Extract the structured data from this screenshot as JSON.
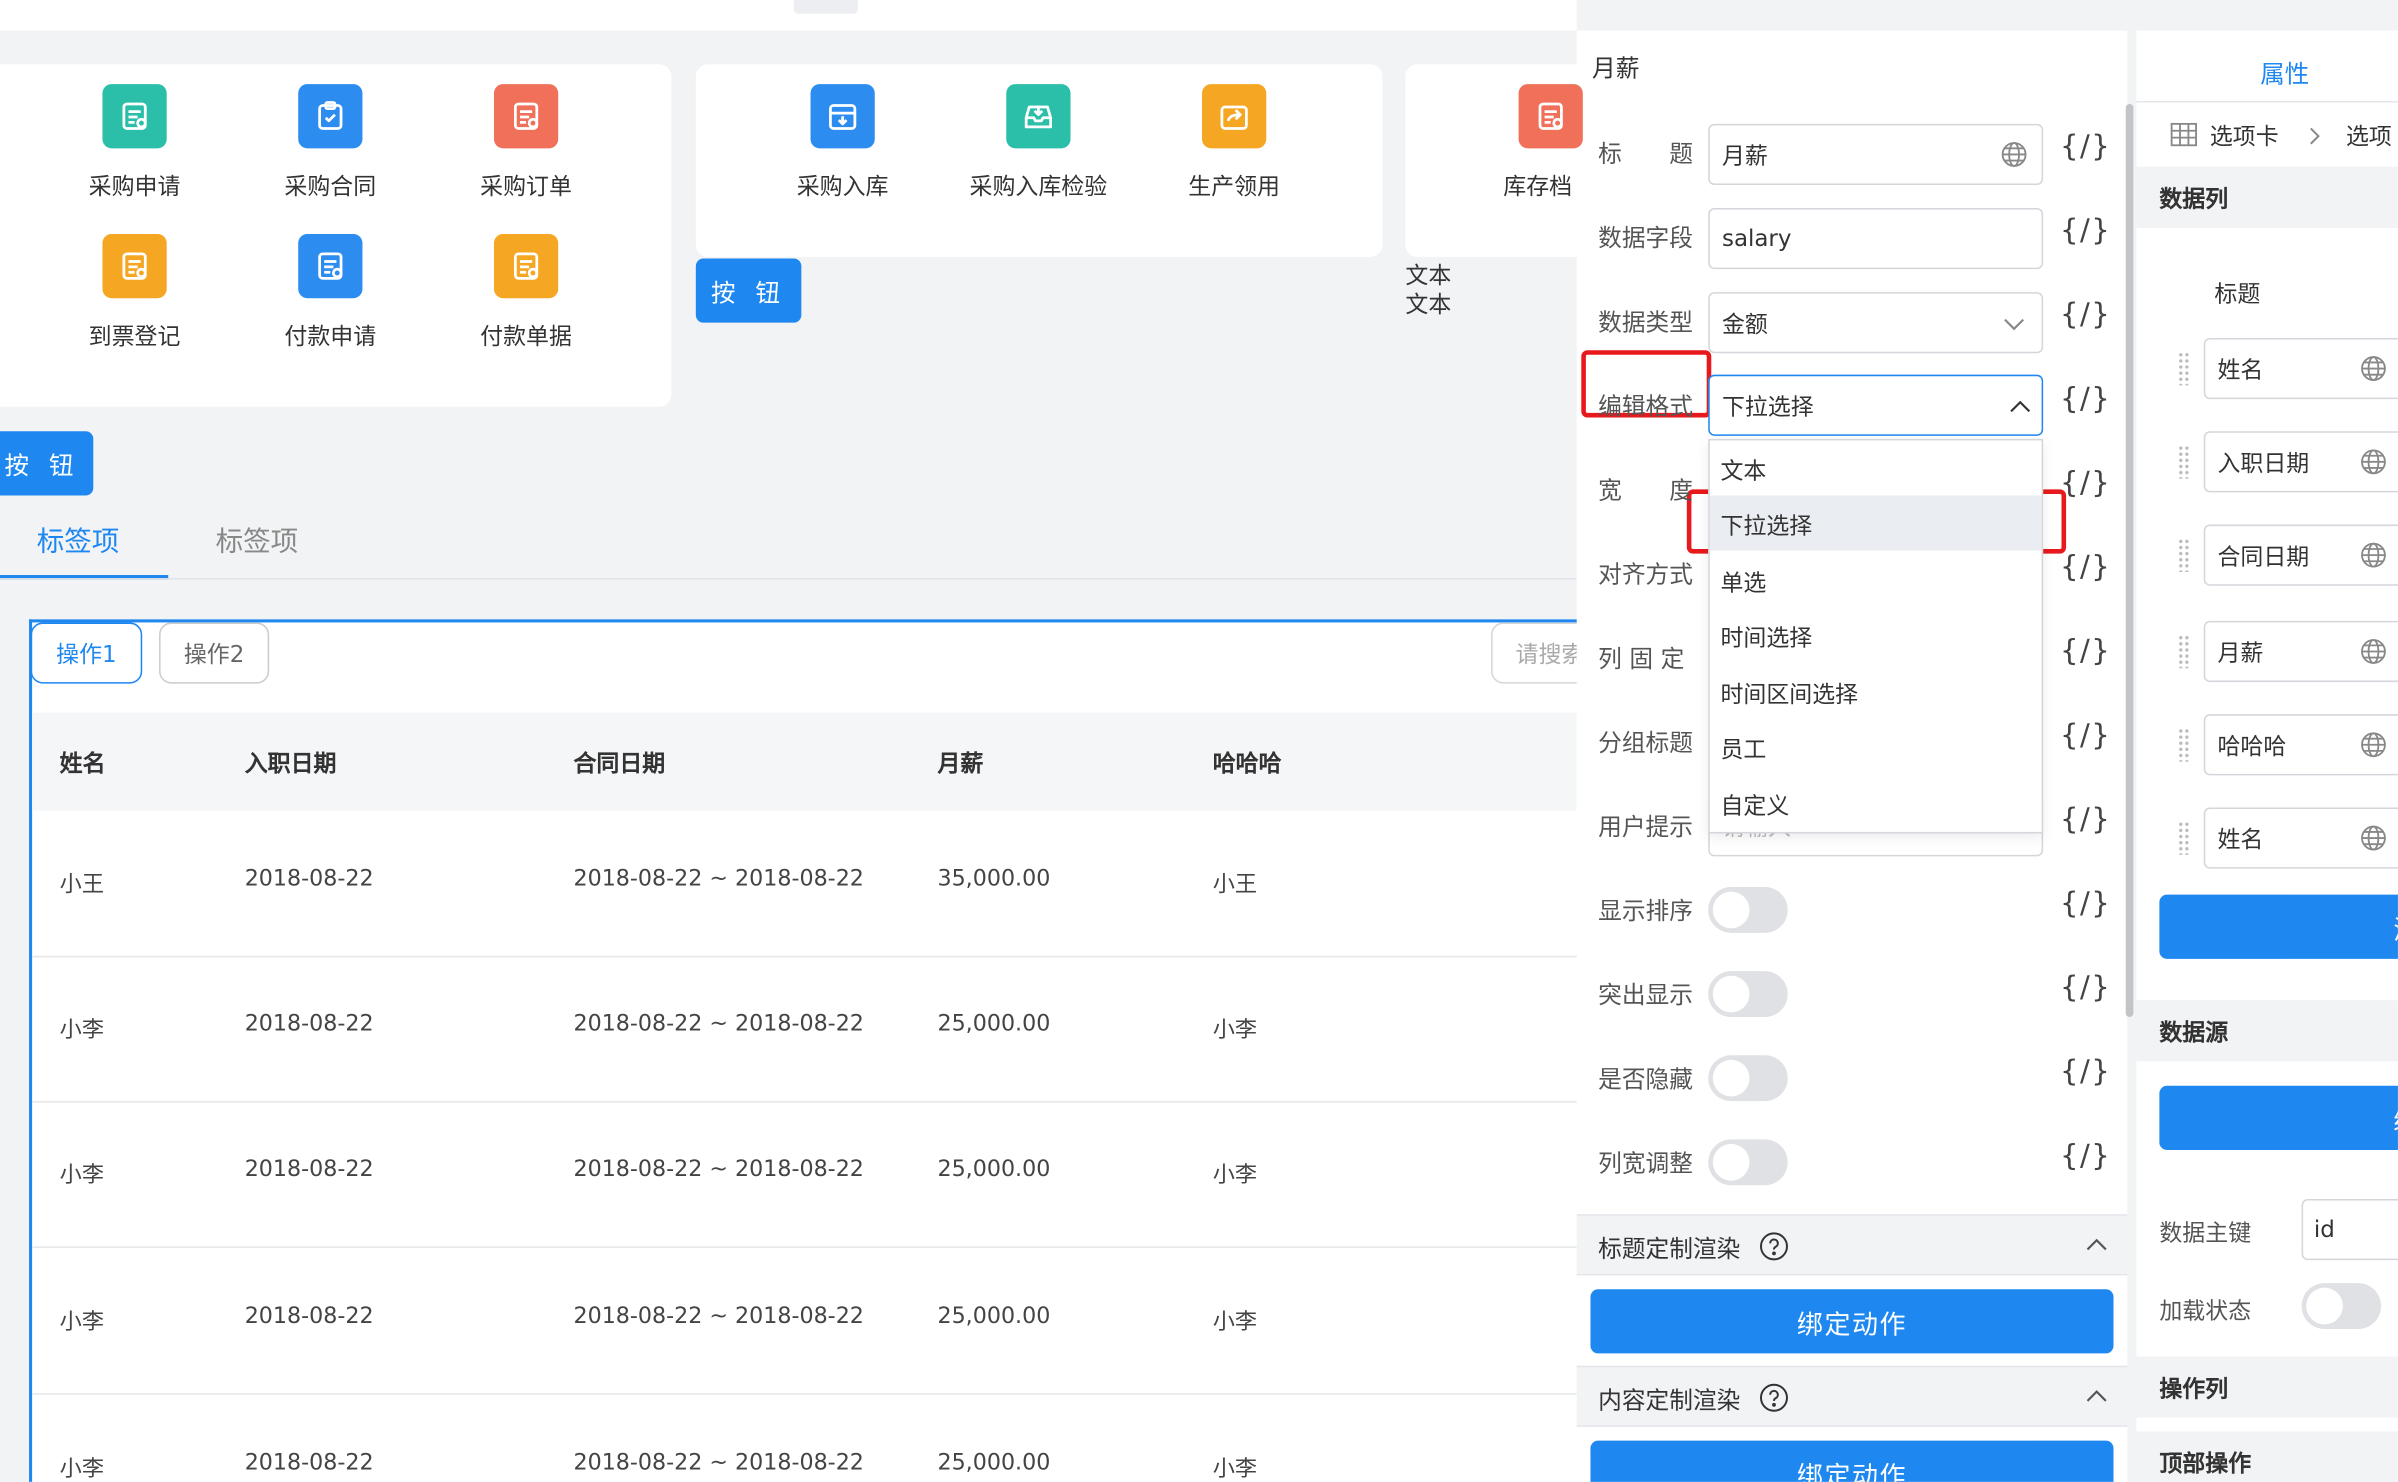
{
  "apps_panel_1": [
    {
      "label": "采购申请",
      "icon": "purchase-request-icon",
      "color": "#2bbfaa"
    },
    {
      "label": "采购合同",
      "icon": "purchase-contract-icon",
      "color": "#2d8cf0"
    },
    {
      "label": "采购订单",
      "icon": "purchase-order-icon",
      "color": "#f0705a"
    },
    {
      "label": "到票登记",
      "icon": "invoice-register-icon",
      "color": "#f5a623"
    },
    {
      "label": "付款申请",
      "icon": "payment-request-icon",
      "color": "#2d8cf0"
    },
    {
      "label": "付款单据",
      "icon": "payment-document-icon",
      "color": "#f5a623"
    }
  ],
  "apps_panel_2": [
    {
      "label": "采购入库",
      "icon": "purchase-inbound-icon",
      "color": "#2d8cf0"
    },
    {
      "label": "采购入库检验",
      "icon": "inbound-inspection-icon",
      "color": "#2bbfaa"
    },
    {
      "label": "生产领用",
      "icon": "production-requisition-icon",
      "color": "#f5a623"
    }
  ],
  "apps_panel_3": [
    {
      "label": "库存档",
      "icon": "inventory-archive-icon",
      "color": "#f0705a"
    }
  ],
  "canvas": {
    "button_1": "按 钮",
    "button_2": "按 钮",
    "text_1": "文本",
    "text_2": "文本",
    "tabs": [
      "标签项",
      "标签项"
    ],
    "op_buttons": [
      "操作1",
      "操作2"
    ],
    "search_placeholder": "请搜索"
  },
  "table": {
    "columns": [
      "姓名",
      "入职日期",
      "合同日期",
      "月薪",
      "哈哈哈"
    ],
    "rows": [
      [
        "小王",
        "2018-08-22",
        "2018-08-22 ~ 2018-08-22",
        "35,000.00",
        "小王"
      ],
      [
        "小李",
        "2018-08-22",
        "2018-08-22 ~ 2018-08-22",
        "25,000.00",
        "小李"
      ],
      [
        "小李",
        "2018-08-22",
        "2018-08-22 ~ 2018-08-22",
        "25,000.00",
        "小李"
      ],
      [
        "小李",
        "2018-08-22",
        "2018-08-22 ~ 2018-08-22",
        "25,000.00",
        "小李"
      ],
      [
        "小李",
        "2018-08-22",
        "2018-08-22 ~ 2018-08-22",
        "25,000.00",
        "小李"
      ]
    ]
  },
  "column_props": {
    "header": "月薪",
    "fields": {
      "title": {
        "label": "标　　题",
        "value": "月薪"
      },
      "data_field": {
        "label": "数据字段",
        "value": "salary"
      },
      "data_type": {
        "label": "数据类型",
        "value": "金额"
      },
      "edit_format": {
        "label": "编辑格式",
        "value": "下拉选择"
      },
      "width": {
        "label": "宽　　度"
      },
      "align": {
        "label": "对齐方式"
      },
      "fixed": {
        "label": "列 固 定"
      },
      "group_title": {
        "label": "分组标题"
      },
      "user_hint": {
        "label": "用户提示",
        "placeholder": "请输入"
      },
      "show_sort": {
        "label": "显示排序"
      },
      "highlight": {
        "label": "突出显示"
      },
      "hidden": {
        "label": "是否隐藏"
      },
      "resizable": {
        "label": "列宽调整"
      }
    },
    "expr_symbol": "{/}",
    "dropdown_options": [
      "文本",
      "下拉选择",
      "单选",
      "时间选择",
      "时间区间选择",
      "员工",
      "自定义"
    ],
    "dropdown_selected": "下拉选择",
    "title_render": {
      "label": "标题定制渲染",
      "button": "绑定动作"
    },
    "content_render": {
      "label": "内容定制渲染",
      "button": "绑定动作"
    }
  },
  "right_panel": {
    "tab": "属性",
    "breadcrumb": [
      "选项卡",
      "选项"
    ],
    "data_columns_title": "数据列",
    "title_header": "标题",
    "columns": [
      "姓名",
      "入职日期",
      "合同日期",
      "月薪",
      "哈哈哈",
      "姓名"
    ],
    "add_button": "添",
    "datasource_title": "数据源",
    "edit_button": "编",
    "primary_key_label": "数据主键",
    "primary_key_value": "id",
    "loading_label": "加载状态",
    "op_column_title": "操作列",
    "top_op_title": "顶部操作"
  }
}
